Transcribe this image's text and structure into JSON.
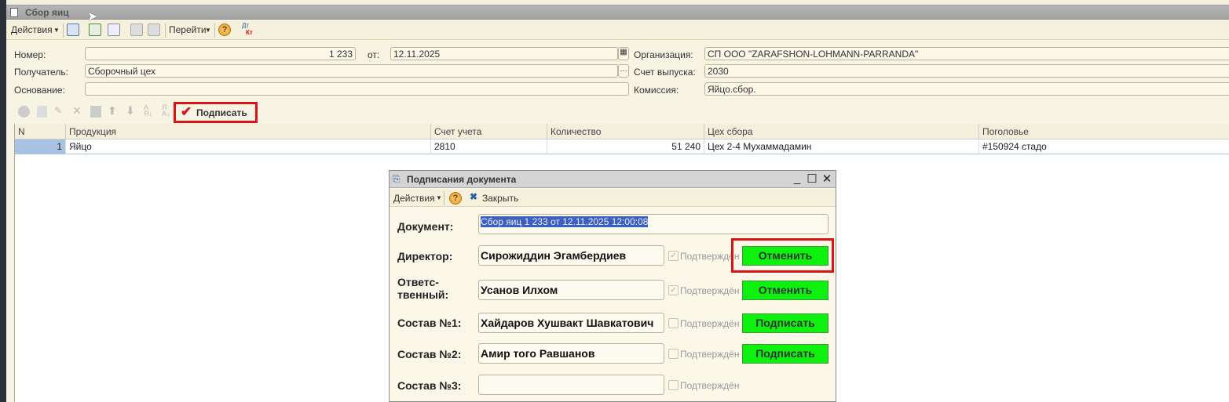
{
  "window": {
    "title": "Сбор яиц"
  },
  "toolbar": {
    "actions": "Действия",
    "goto": "Перейти",
    "help": "?",
    "dt": "Дт",
    "kt": "Кт"
  },
  "form": {
    "number_label": "Номер:",
    "number": "1 233",
    "date_label": "от:",
    "date": "12.11.2025",
    "recipient_label": "Получатель:",
    "recipient": "Сборочный цех",
    "basis_label": "Основание:",
    "basis": "",
    "org_label": "Организация:",
    "org": "СП ООО \"ZARAFSHON-LOHMANN-PARRANDA\"",
    "account_label": "Счет выпуска:",
    "account": "2030",
    "commission_label": "Комиссия:",
    "commission": "Яйцо.сбор."
  },
  "table_toolbar": {
    "sign": "Подписать"
  },
  "table": {
    "columns": [
      "N",
      "Продукция",
      "Счет учета",
      "Количество",
      "Цех сбора",
      "Поголовье"
    ],
    "rows": [
      {
        "n": "1",
        "product": "Яйцо",
        "account": "2810",
        "qty": "51 240",
        "shop": "Цех 2-4 Мухаммадамин",
        "herd": "#150924 стадо"
      }
    ]
  },
  "dialog": {
    "title": "Подписания документа",
    "actions": "Действия",
    "help": "?",
    "close": "Закрыть",
    "doc_label": "Документ:",
    "doc": "Сбор яиц 1 233 от 12.11.2025 12:00:08",
    "confirmed": "Подтверждён",
    "rows": [
      {
        "label": "Директор:",
        "name": "Сирожиддин Эгамбердиев",
        "checked": true,
        "button": "Отменить"
      },
      {
        "label": "Ответс-\nтвенный:",
        "name": "Усанов Илхом",
        "checked": true,
        "button": "Отменить"
      },
      {
        "label": "Состав №1:",
        "name": "Хайдаров Хушвакт Шавкатович",
        "checked": false,
        "button": "Подписать"
      },
      {
        "label": "Состав №2:",
        "name": "Амир того Равшанов",
        "checked": false,
        "button": "Подписать"
      },
      {
        "label": "Состав №3:",
        "name": "",
        "checked": false
      }
    ]
  }
}
